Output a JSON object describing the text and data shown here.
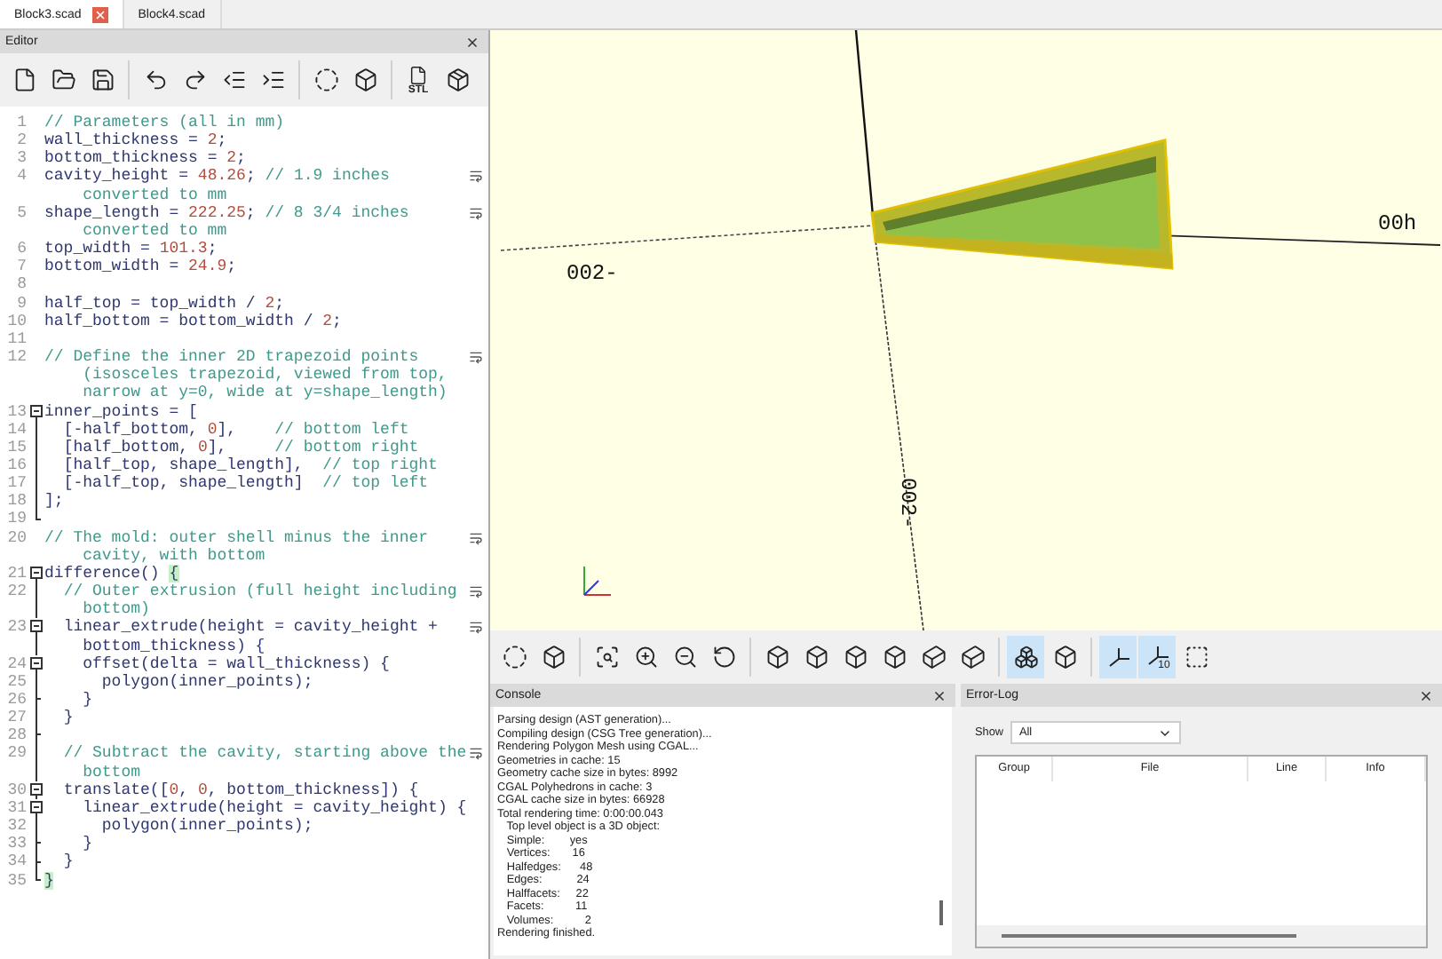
{
  "tabs": [
    {
      "label": "Block3.scad",
      "selected": true
    },
    {
      "label": "Block4.scad",
      "selected": false
    }
  ],
  "editor": {
    "title": "Editor",
    "toolbar": [
      {
        "kind": "new"
      },
      {
        "kind": "open"
      },
      {
        "kind": "save"
      },
      {
        "kind": "separator"
      },
      {
        "kind": "undo"
      },
      {
        "kind": "redo"
      },
      {
        "kind": "unindent"
      },
      {
        "kind": "indent"
      },
      {
        "kind": "separator"
      },
      {
        "kind": "preview"
      },
      {
        "kind": "render"
      },
      {
        "kind": "separator"
      },
      {
        "kind": "export",
        "label": "STL"
      },
      {
        "kind": "print"
      }
    ],
    "lines": [
      {
        "n": "1",
        "kind": "plain",
        "segments": [
          {
            "kind": "comment",
            "text": "// Parameters (all in mm)"
          }
        ]
      },
      {
        "n": "2",
        "kind": "plain",
        "segments": [
          {
            "kind": "code",
            "text": "wall_thickness = "
          },
          {
            "kind": "number",
            "text": "2"
          },
          {
            "kind": "code",
            "text": ";"
          }
        ]
      },
      {
        "n": "3",
        "kind": "plain",
        "segments": [
          {
            "kind": "code",
            "text": "bottom_thickness = "
          },
          {
            "kind": "number",
            "text": "2"
          },
          {
            "kind": "code",
            "text": ";"
          }
        ]
      },
      {
        "n": "4",
        "kind": "plain",
        "wrapped": true,
        "segments": [
          {
            "kind": "code",
            "text": "cavity_height = "
          },
          {
            "kind": "number",
            "text": "48.26"
          },
          {
            "kind": "code",
            "text": "; "
          },
          {
            "kind": "comment",
            "text": "// 1.9 inches converted to mm"
          }
        ]
      },
      {
        "n": "5",
        "kind": "plain",
        "wrapped": true,
        "segments": [
          {
            "kind": "code",
            "text": "shape_length = "
          },
          {
            "kind": "number",
            "text": "222.25"
          },
          {
            "kind": "code",
            "text": "; "
          },
          {
            "kind": "comment",
            "text": "// 8 3/4 inches converted to mm"
          }
        ]
      },
      {
        "n": "6",
        "kind": "plain",
        "segments": [
          {
            "kind": "code",
            "text": "top_width = "
          },
          {
            "kind": "number",
            "text": "101.3"
          },
          {
            "kind": "code",
            "text": ";"
          }
        ]
      },
      {
        "n": "7",
        "kind": "plain",
        "segments": [
          {
            "kind": "code",
            "text": "bottom_width = "
          },
          {
            "kind": "number",
            "text": "24.9"
          },
          {
            "kind": "code",
            "text": ";"
          }
        ]
      },
      {
        "n": "8",
        "kind": "plain"
      },
      {
        "n": "9",
        "kind": "plain",
        "segments": [
          {
            "kind": "code",
            "text": "half_top = top_width / "
          },
          {
            "kind": "number",
            "text": "2"
          },
          {
            "kind": "code",
            "text": ";"
          }
        ]
      },
      {
        "n": "10",
        "kind": "plain",
        "segments": [
          {
            "kind": "code",
            "text": "half_bottom = bottom_width / "
          },
          {
            "kind": "number",
            "text": "2"
          },
          {
            "kind": "code",
            "text": ";"
          }
        ]
      },
      {
        "n": "11",
        "kind": "plain"
      },
      {
        "n": "12",
        "kind": "plain",
        "wrapped": true,
        "segments": [
          {
            "kind": "comment",
            "text": "// Define the inner 2D trapezoid points (isosceles trapezoid, viewed from top, narrow at y=0, wide at y=shape_length)"
          }
        ]
      },
      {
        "n": "13",
        "kind": "fold-start",
        "segments": [
          {
            "kind": "code",
            "text": "inner_points = ["
          }
        ]
      },
      {
        "n": "14",
        "kind": "fold-line",
        "segments": [
          {
            "kind": "code",
            "text": "  [-half_bottom, "
          },
          {
            "kind": "number",
            "text": "0"
          },
          {
            "kind": "code",
            "text": "],    "
          },
          {
            "kind": "comment",
            "text": "// bottom left"
          }
        ]
      },
      {
        "n": "15",
        "kind": "fold-line",
        "segments": [
          {
            "kind": "code",
            "text": "  [half_bottom, "
          },
          {
            "kind": "number",
            "text": "0"
          },
          {
            "kind": "code",
            "text": "],     "
          },
          {
            "kind": "comment",
            "text": "// bottom right"
          }
        ]
      },
      {
        "n": "16",
        "kind": "fold-line",
        "segments": [
          {
            "kind": "code",
            "text": "  [half_top, shape_length],  "
          },
          {
            "kind": "comment",
            "text": "// top right"
          }
        ]
      },
      {
        "n": "17",
        "kind": "fold-line",
        "segments": [
          {
            "kind": "code",
            "text": "  [-half_top, shape_length]  "
          },
          {
            "kind": "comment",
            "text": "// top left"
          }
        ]
      },
      {
        "n": "18",
        "kind": "fold-line",
        "segments": [
          {
            "kind": "code",
            "text": "];"
          }
        ]
      },
      {
        "n": "19",
        "kind": "fold-end"
      },
      {
        "n": "20",
        "kind": "plain",
        "wrapped": true,
        "segments": [
          {
            "kind": "comment",
            "text": "// The mold: outer shell minus the inner cavity, with bottom"
          }
        ]
      },
      {
        "n": "21",
        "kind": "fold-start",
        "segments": [
          {
            "kind": "code",
            "text": "difference() "
          },
          {
            "kind": "match",
            "text": "{"
          }
        ]
      },
      {
        "n": "22",
        "kind": "fold-line",
        "wrapped": true,
        "segments": [
          {
            "kind": "comment",
            "text": "  // Outer extrusion (full height including bottom)"
          }
        ]
      },
      {
        "n": "23",
        "kind": "fold-start",
        "wrapped": true,
        "segments": [
          {
            "kind": "code",
            "text": "  linear_extrude(height = cavity_height + bottom_thickness) {"
          }
        ]
      },
      {
        "n": "24",
        "kind": "fold-start",
        "segments": [
          {
            "kind": "code",
            "text": "    offset(delta = wall_thickness) {"
          }
        ]
      },
      {
        "n": "25",
        "kind": "fold-line",
        "segments": [
          {
            "kind": "code",
            "text": "      polygon(inner_points);"
          }
        ]
      },
      {
        "n": "26",
        "kind": "fold-tick",
        "segments": [
          {
            "kind": "code",
            "text": "    }"
          }
        ]
      },
      {
        "n": "27",
        "kind": "fold-line",
        "segments": [
          {
            "kind": "code",
            "text": "  }"
          }
        ]
      },
      {
        "n": "28",
        "kind": "fold-tick"
      },
      {
        "n": "29",
        "kind": "fold-line",
        "wrapped": true,
        "segments": [
          {
            "kind": "comment",
            "text": "  // Subtract the cavity, starting above the bottom"
          }
        ]
      },
      {
        "n": "30",
        "kind": "fold-start",
        "segments": [
          {
            "kind": "code",
            "text": "  translate(["
          },
          {
            "kind": "number",
            "text": "0"
          },
          {
            "kind": "code",
            "text": ", "
          },
          {
            "kind": "number",
            "text": "0"
          },
          {
            "kind": "code",
            "text": ", bottom_thickness]) {"
          }
        ]
      },
      {
        "n": "31",
        "kind": "fold-start",
        "segments": [
          {
            "kind": "code",
            "text": "    linear_extrude(height = cavity_height) {"
          }
        ]
      },
      {
        "n": "32",
        "kind": "fold-line",
        "segments": [
          {
            "kind": "code",
            "text": "      polygon(inner_points);"
          }
        ]
      },
      {
        "n": "33",
        "kind": "fold-tick",
        "segments": [
          {
            "kind": "code",
            "text": "    }"
          }
        ]
      },
      {
        "n": "34",
        "kind": "fold-tick",
        "segments": [
          {
            "kind": "code",
            "text": "  }"
          }
        ]
      },
      {
        "n": "35",
        "kind": "fold-end",
        "segments": [
          {
            "kind": "match",
            "text": "}"
          }
        ]
      }
    ]
  },
  "viewport": {
    "axis_labels": [
      {
        "kind": "horizontal-left",
        "text": "002-"
      },
      {
        "kind": "horizontal-right",
        "text": "00h"
      },
      {
        "kind": "vertical",
        "text": "002-"
      }
    ]
  },
  "view_toolbar": [
    {
      "kind": "preview",
      "selected": false
    },
    {
      "kind": "render",
      "selected": false
    },
    {
      "kind": "separator"
    },
    {
      "kind": "view-all",
      "selected": false
    },
    {
      "kind": "zoom-in",
      "selected": false
    },
    {
      "kind": "zoom-out",
      "selected": false
    },
    {
      "kind": "reset",
      "selected": false
    },
    {
      "kind": "separator"
    },
    {
      "kind": "right",
      "selected": false
    },
    {
      "kind": "top",
      "selected": false
    },
    {
      "kind": "bottom",
      "selected": false
    },
    {
      "kind": "left",
      "selected": false
    },
    {
      "kind": "front",
      "selected": false
    },
    {
      "kind": "back",
      "selected": false
    },
    {
      "kind": "separator"
    },
    {
      "kind": "perspective",
      "selected": true
    },
    {
      "kind": "orthogonal",
      "selected": false
    },
    {
      "kind": "separator"
    },
    {
      "kind": "axes",
      "selected": true
    },
    {
      "kind": "scale",
      "selected": true,
      "label": "10"
    },
    {
      "kind": "edges",
      "selected": false
    }
  ],
  "console": {
    "title": "Console",
    "lines": [
      "Parsing design (AST generation)...",
      "Compiling design (CSG Tree generation)...",
      "Rendering Polygon Mesh using CGAL...",
      "Geometries in cache: 15",
      "Geometry cache size in bytes: 8992",
      "CGAL Polyhedrons in cache: 3",
      "CGAL cache size in bytes: 66928",
      "Total rendering time: 0:00:00.043",
      "   Top level object is a 3D object:",
      "   Simple:        yes",
      "   Vertices:       16",
      "   Halfedges:      48",
      "   Edges:           24",
      "   Halffacets:     22",
      "   Facets:          11",
      "   Volumes:          2",
      "Rendering finished."
    ]
  },
  "error_log": {
    "title": "Error-Log",
    "show_label": "Show",
    "show_value": "All",
    "columns": [
      "Group",
      "File",
      "Line",
      "Info"
    ]
  }
}
